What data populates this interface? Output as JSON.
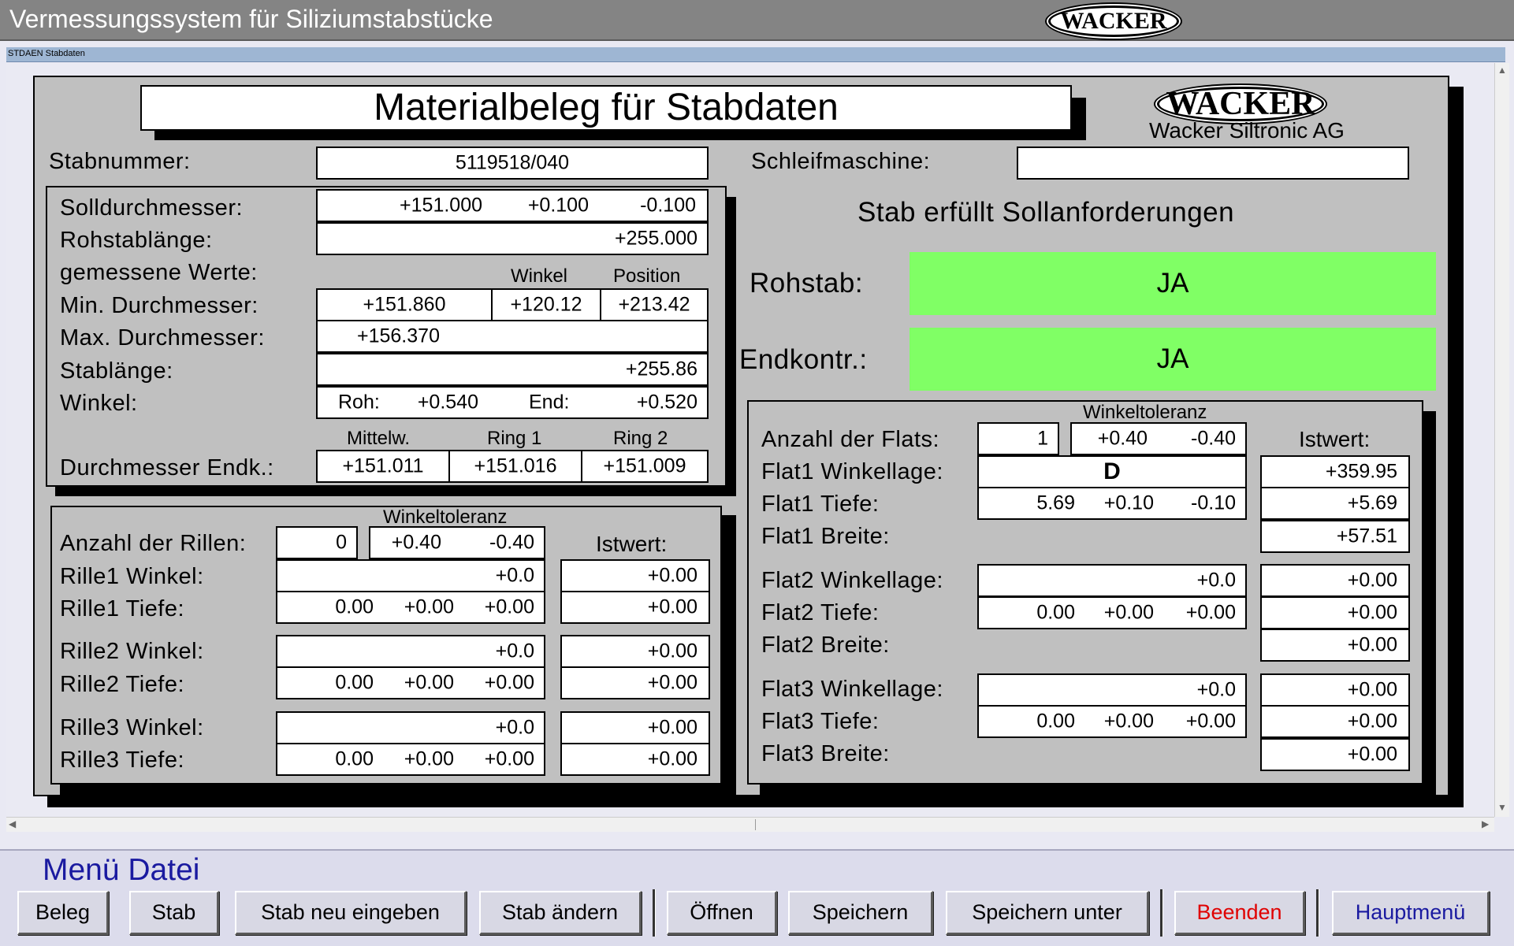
{
  "window": {
    "title": "Vermessungssystem für Siliziumstabstücke",
    "logo": "WACKER",
    "subwindow_title": "STDAEN Stabdaten"
  },
  "banner": {
    "title": "Materialbeleg für Stabdaten",
    "logo": "WACKER",
    "company": "Wacker Siltronic AG"
  },
  "stab": {
    "label": "Stabnummer:",
    "value": "5119518/040"
  },
  "schleif": {
    "label": "Schleifmaschine:",
    "value": ""
  },
  "measure": {
    "soll_label": "Solldurchmesser:",
    "soll_value": "+151.000",
    "soll_plus": "+0.100",
    "soll_minus": "-0.100",
    "rohlen_label": "Rohstablänge:",
    "rohlen_value": "+255.000",
    "gemessen_label": "gemessene Werte:",
    "winkel_header": "Winkel",
    "position_header": "Position",
    "min_label": "Min. Durchmesser:",
    "min_value": "+151.860",
    "min_winkel": "+120.12",
    "min_position": "+213.42",
    "max_label": "Max. Durchmesser:",
    "max_value": "+156.370",
    "stablen_label": "Stablänge:",
    "stablen_value": "+255.86",
    "winkel_label": "Winkel:",
    "roh_label": "Roh:",
    "roh_value": "+0.540",
    "end_label": "End:",
    "end_value": "+0.520",
    "mittel_header": "Mittelw.",
    "ring1_header": "Ring 1",
    "ring2_header": "Ring 2",
    "endk_label": "Durchmesser Endk.:",
    "endk_mittel": "+151.011",
    "endk_ring1": "+151.016",
    "endk_ring2": "+151.009"
  },
  "status": {
    "text": "Stab erfüllt Sollanforderungen",
    "rohstab_label": "Rohstab:",
    "rohstab_value": "JA",
    "endkontr_label": "Endkontr.:",
    "endkontr_value": "JA",
    "ok_color": "#80ff65"
  },
  "rillen": {
    "tol_header": "Winkeltoleranz",
    "anzahl_label": "Anzahl der Rillen:",
    "anzahl_value": "0",
    "tol_plus": "+0.40",
    "tol_minus": "-0.40",
    "ist_header": "Istwert:",
    "items": [
      {
        "winkel_label": "Rille1 Winkel:",
        "winkel": "+0.0",
        "winkel_ist": "+0.00",
        "tiefe_label": "Rille1 Tiefe:",
        "tiefe": "0.00",
        "tiefe_plus": "+0.00",
        "tiefe_minus": "+0.00",
        "tiefe_ist": "+0.00"
      },
      {
        "winkel_label": "Rille2 Winkel:",
        "winkel": "+0.0",
        "winkel_ist": "+0.00",
        "tiefe_label": "Rille2 Tiefe:",
        "tiefe": "0.00",
        "tiefe_plus": "+0.00",
        "tiefe_minus": "+0.00",
        "tiefe_ist": "+0.00"
      },
      {
        "winkel_label": "Rille3 Winkel:",
        "winkel": "+0.0",
        "winkel_ist": "+0.00",
        "tiefe_label": "Rille3 Tiefe:",
        "tiefe": "0.00",
        "tiefe_plus": "+0.00",
        "tiefe_minus": "+0.00",
        "tiefe_ist": "+0.00"
      }
    ]
  },
  "flats": {
    "tol_header": "Winkeltoleranz",
    "anzahl_label": "Anzahl der Flats:",
    "anzahl_value": "1",
    "tol_plus": "+0.40",
    "tol_minus": "-0.40",
    "ist_header": "Istwert:",
    "items": [
      {
        "winkel_label": "Flat1 Winkellage:",
        "winkel": "D",
        "winkel_ist": "+359.95",
        "tiefe_label": "Flat1 Tiefe:",
        "tiefe": "5.69",
        "tiefe_plus": "+0.10",
        "tiefe_minus": "-0.10",
        "tiefe_ist": "+5.69",
        "breite_label": "Flat1 Breite:",
        "breite_ist": "+57.51"
      },
      {
        "winkel_label": "Flat2 Winkellage:",
        "winkel": "+0.0",
        "winkel_ist": "+0.00",
        "tiefe_label": "Flat2 Tiefe:",
        "tiefe": "0.00",
        "tiefe_plus": "+0.00",
        "tiefe_minus": "+0.00",
        "tiefe_ist": "+0.00",
        "breite_label": "Flat2 Breite:",
        "breite_ist": "+0.00"
      },
      {
        "winkel_label": "Flat3 Winkellage:",
        "winkel": "+0.0",
        "winkel_ist": "+0.00",
        "tiefe_label": "Flat3 Tiefe:",
        "tiefe": "0.00",
        "tiefe_plus": "+0.00",
        "tiefe_minus": "+0.00",
        "tiefe_ist": "+0.00",
        "breite_label": "Flat3 Breite:",
        "breite_ist": "+0.00"
      }
    ]
  },
  "menu": {
    "title": "Menü Datei",
    "buttons": [
      "Beleg",
      "Stab",
      "Stab neu eingeben",
      "Stab ändern",
      "Öffnen",
      "Speichern",
      "Speichern unter",
      "Beenden",
      "Hauptmenü"
    ],
    "beenden_color": "#e00000",
    "hauptmenu_color": "#1a1aa0"
  }
}
